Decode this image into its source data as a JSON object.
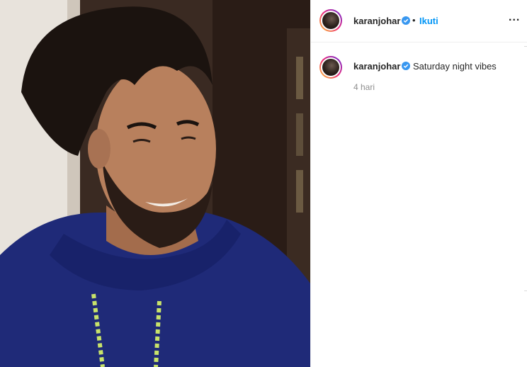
{
  "post": {
    "media": {
      "alt_icon": "photo",
      "palette": {
        "hoodie": "#1f2a78",
        "drawstring": "#c8e36a",
        "hair": "#1b130f",
        "skin": "#b27a58",
        "wall_left": "#e9e4dd",
        "wall_right": "#3a2a22"
      }
    },
    "header": {
      "username": "karanjohar",
      "separator": "•",
      "follow_label": "Ikuti",
      "more_label": "..."
    },
    "caption": {
      "username": "karanjohar",
      "text": "Saturday night vibes",
      "time": "4 hari"
    }
  },
  "colors": {
    "accent": "#0095f6",
    "verified": "#3897f0",
    "text": "#262626",
    "muted": "#8e8e8e",
    "divider": "#efefef"
  }
}
